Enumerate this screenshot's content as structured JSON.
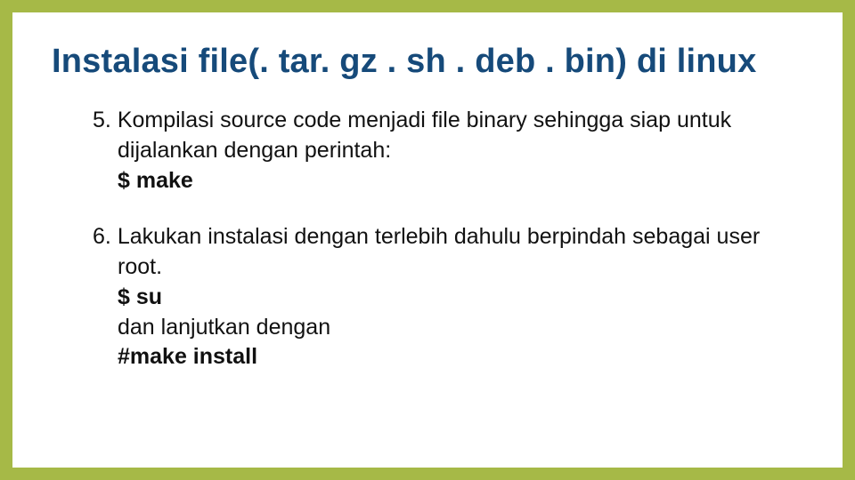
{
  "title": "Instalasi file(. tar. gz . sh . deb . bin) di linux",
  "items": [
    {
      "num": "5.",
      "text1": "Kompilasi source code menjadi file binary sehingga siap untuk dijalankan dengan perintah:",
      "cmd1": "$ make"
    },
    {
      "num": "6.",
      "text1": "Lakukan instalasi  dengan terlebih dahulu berpindah sebagai user root.",
      "cmd1": "$ su",
      "text2": "dan lanjutkan dengan",
      "cmd2": "#make install"
    }
  ]
}
